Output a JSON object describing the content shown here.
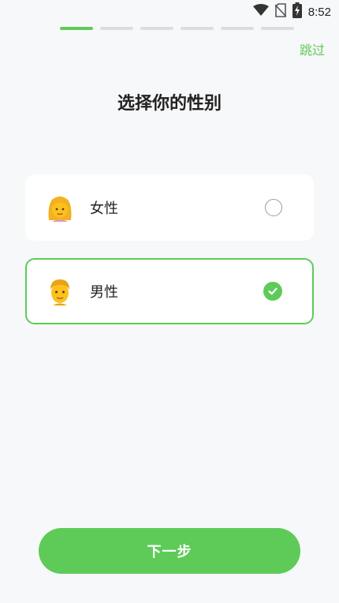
{
  "status_bar": {
    "time": "8:52",
    "icons": [
      "wifi-icon",
      "no-sim-icon",
      "battery-charging-icon"
    ]
  },
  "onboarding": {
    "progress": {
      "total_steps": 6,
      "current_step": 1
    },
    "skip_label": "跳过",
    "title": "选择你的性别",
    "options": [
      {
        "label": "女性",
        "icon": "woman-blond-emoji-icon",
        "selected": false
      },
      {
        "label": "男性",
        "icon": "man-blond-emoji-icon",
        "selected": true
      }
    ],
    "next_label": "下一步"
  },
  "colors": {
    "accent": "#5ecb58",
    "background": "#f7f8fa",
    "card": "#ffffff",
    "progress_inactive": "#dcdde0"
  }
}
